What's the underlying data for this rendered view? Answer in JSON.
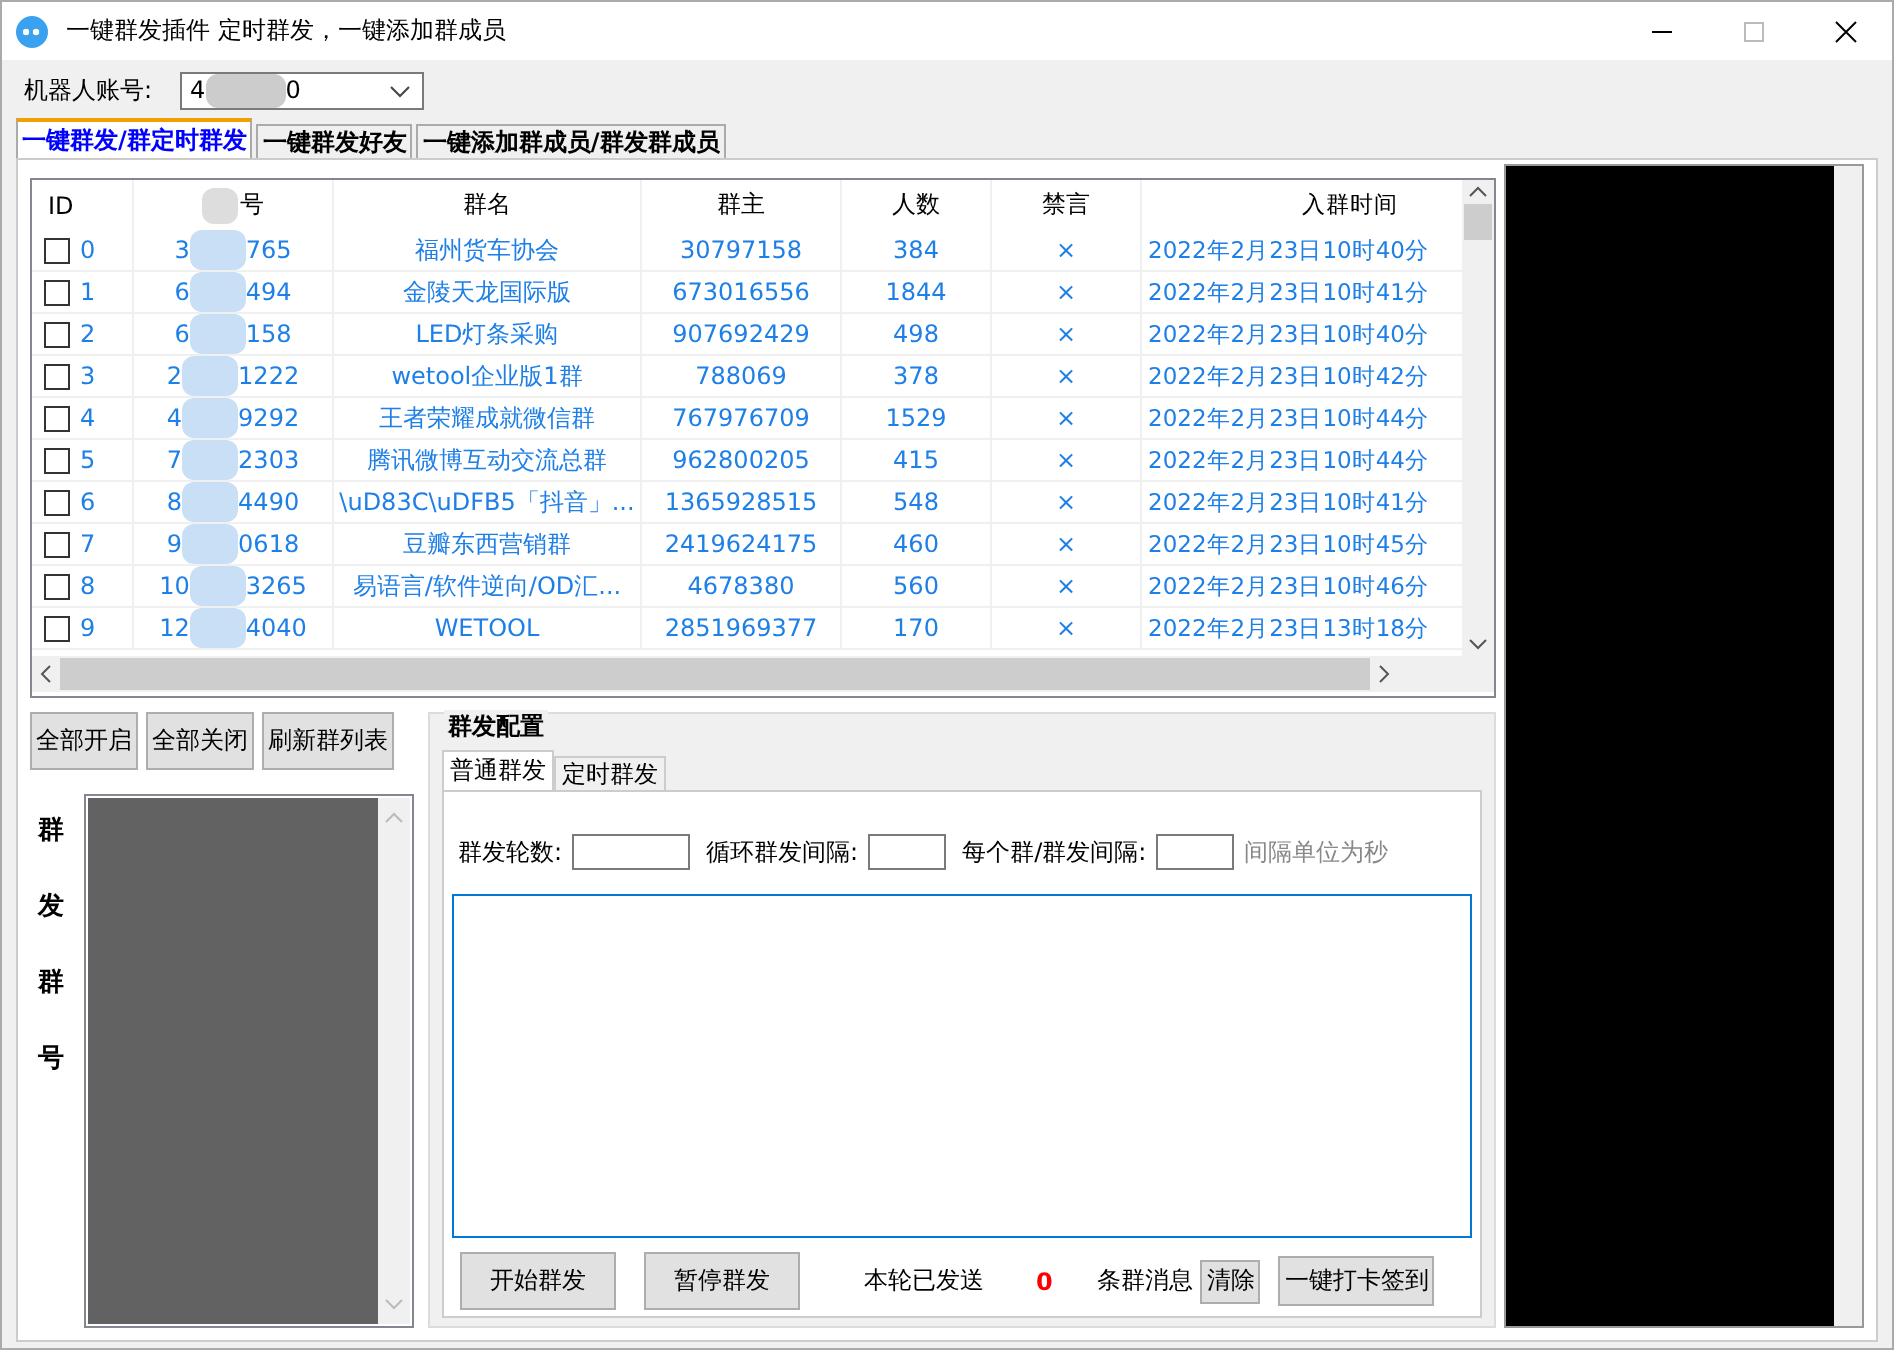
{
  "window": {
    "title": "一键群发插件  定时群发，一键添加群成员"
  },
  "account": {
    "label": "机器人账号:",
    "value_head": "4",
    "value_tail": "0"
  },
  "tabs": [
    {
      "label": "一键群发/群定时群发",
      "selected": true
    },
    {
      "label": "一键群发好友",
      "selected": false
    },
    {
      "label": "一键添加群成员/群发群成员",
      "selected": false
    }
  ],
  "table": {
    "columns": [
      "ID",
      "号",
      "群名",
      "群主",
      "人数",
      "禁言",
      "入群时间"
    ],
    "rows": [
      {
        "checked": false,
        "id": "0",
        "no_head": "3",
        "no_tail": "765",
        "name": "福州货车协会",
        "owner": "30797158",
        "members": "384",
        "muted": "×",
        "joined": "2022年2月23日10时40分"
      },
      {
        "checked": false,
        "id": "1",
        "no_head": "6",
        "no_tail": "494",
        "name": "金陵天龙国际版",
        "owner": "673016556",
        "members": "1844",
        "muted": "×",
        "joined": "2022年2月23日10时41分"
      },
      {
        "checked": false,
        "id": "2",
        "no_head": "6",
        "no_tail": "158",
        "name": "LED灯条采购",
        "owner": "907692429",
        "members": "498",
        "muted": "×",
        "joined": "2022年2月23日10时40分"
      },
      {
        "checked": false,
        "id": "3",
        "no_head": "2",
        "no_tail": "1222",
        "name": "wetool企业版1群",
        "owner": "788069",
        "members": "378",
        "muted": "×",
        "joined": "2022年2月23日10时42分"
      },
      {
        "checked": false,
        "id": "4",
        "no_head": "4",
        "no_tail": "9292",
        "name": "王者荣耀成就微信群",
        "owner": "767976709",
        "members": "1529",
        "muted": "×",
        "joined": "2022年2月23日10时44分"
      },
      {
        "checked": false,
        "id": "5",
        "no_head": "7",
        "no_tail": "2303",
        "name": "腾讯微博互动交流总群",
        "owner": "962800205",
        "members": "415",
        "muted": "×",
        "joined": "2022年2月23日10时44分"
      },
      {
        "checked": false,
        "id": "6",
        "no_head": "8",
        "no_tail": "4490",
        "name": "\\uD83C\\uDFB5「抖音」...",
        "owner": "1365928515",
        "members": "548",
        "muted": "×",
        "joined": "2022年2月23日10时41分"
      },
      {
        "checked": false,
        "id": "7",
        "no_head": "9",
        "no_tail": "0618",
        "name": "豆瓣东西营销群",
        "owner": "2419624175",
        "members": "460",
        "muted": "×",
        "joined": "2022年2月23日10时45分"
      },
      {
        "checked": false,
        "id": "8",
        "no_head": "10",
        "no_tail": "3265",
        "name": "易语言/软件逆向/OD汇...",
        "owner": "4678380",
        "members": "560",
        "muted": "×",
        "joined": "2022年2月23日10时46分"
      },
      {
        "checked": false,
        "id": "9",
        "no_head": "12",
        "no_tail": "4040",
        "name": "WETOOL",
        "owner": "2851969377",
        "members": "170",
        "muted": "×",
        "joined": "2022年2月23日13时18分"
      }
    ]
  },
  "list_buttons": [
    "全部开启",
    "全部关闭",
    "刷新群列表"
  ],
  "group_list": {
    "label": "群发群号"
  },
  "config": {
    "title": "群发配置",
    "tabs": [
      {
        "label": "普通群发",
        "selected": true
      },
      {
        "label": "定时群发",
        "selected": false
      }
    ],
    "fields": [
      {
        "label": "群发轮数:"
      },
      {
        "label": "循环群发间隔:"
      },
      {
        "label": "每个群/群发间隔:"
      }
    ],
    "hint": "间隔单位为秒",
    "start_button": "开始群发",
    "pause_button": "暂停群发",
    "sent_label": "本轮已发送",
    "sent_count": "0",
    "sent_suffix": "条群消息",
    "clear_button": "清除",
    "checkin_button": "一键打卡签到"
  }
}
